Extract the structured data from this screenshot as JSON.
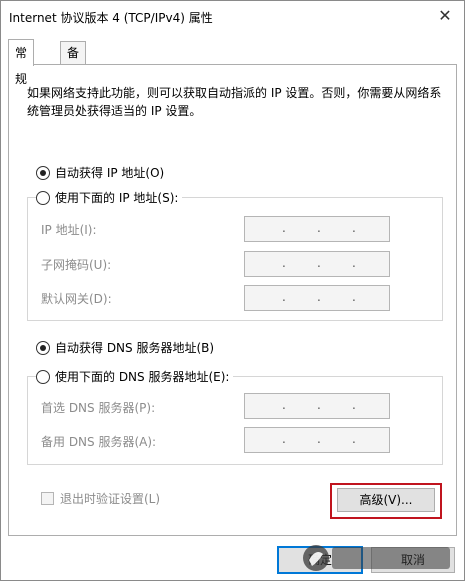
{
  "window": {
    "title": "Internet 协议版本 4 (TCP/IPv4) 属性",
    "close_glyph": "✕"
  },
  "tabs": [
    {
      "label": "常规",
      "active": true
    },
    {
      "label": "备用配置",
      "active": false
    }
  ],
  "description": "如果网络支持此功能，则可以获取自动指派的 IP 设置。否则，你需要从网络系统管理员处获得适当的 IP 设置。",
  "ip": {
    "auto_label": "自动获得 IP 地址(O)",
    "auto_selected": true,
    "manual_label": "使用下面的 IP 地址(S):",
    "manual_selected": false,
    "fields": [
      {
        "label": "IP 地址(I):",
        "dots": ". . ."
      },
      {
        "label": "子网掩码(U):",
        "dots": ". . ."
      },
      {
        "label": "默认网关(D):",
        "dots": ". . ."
      }
    ]
  },
  "dns": {
    "auto_label": "自动获得 DNS 服务器地址(B)",
    "auto_selected": true,
    "manual_label": "使用下面的 DNS 服务器地址(E):",
    "manual_selected": false,
    "fields": [
      {
        "label": "首选 DNS 服务器(P):"
      },
      {
        "label": "备用 DNS 服务器(A):"
      }
    ]
  },
  "validate": {
    "label": "退出时验证设置(L)",
    "checked": false,
    "enabled": false
  },
  "buttons": {
    "advanced": "高级(V)...",
    "ok": "确定",
    "cancel": "取消"
  },
  "colors": {
    "highlight": "#c0141e",
    "disabled_text": "#8c8c8c",
    "field_bg": "#f4f4f4"
  }
}
